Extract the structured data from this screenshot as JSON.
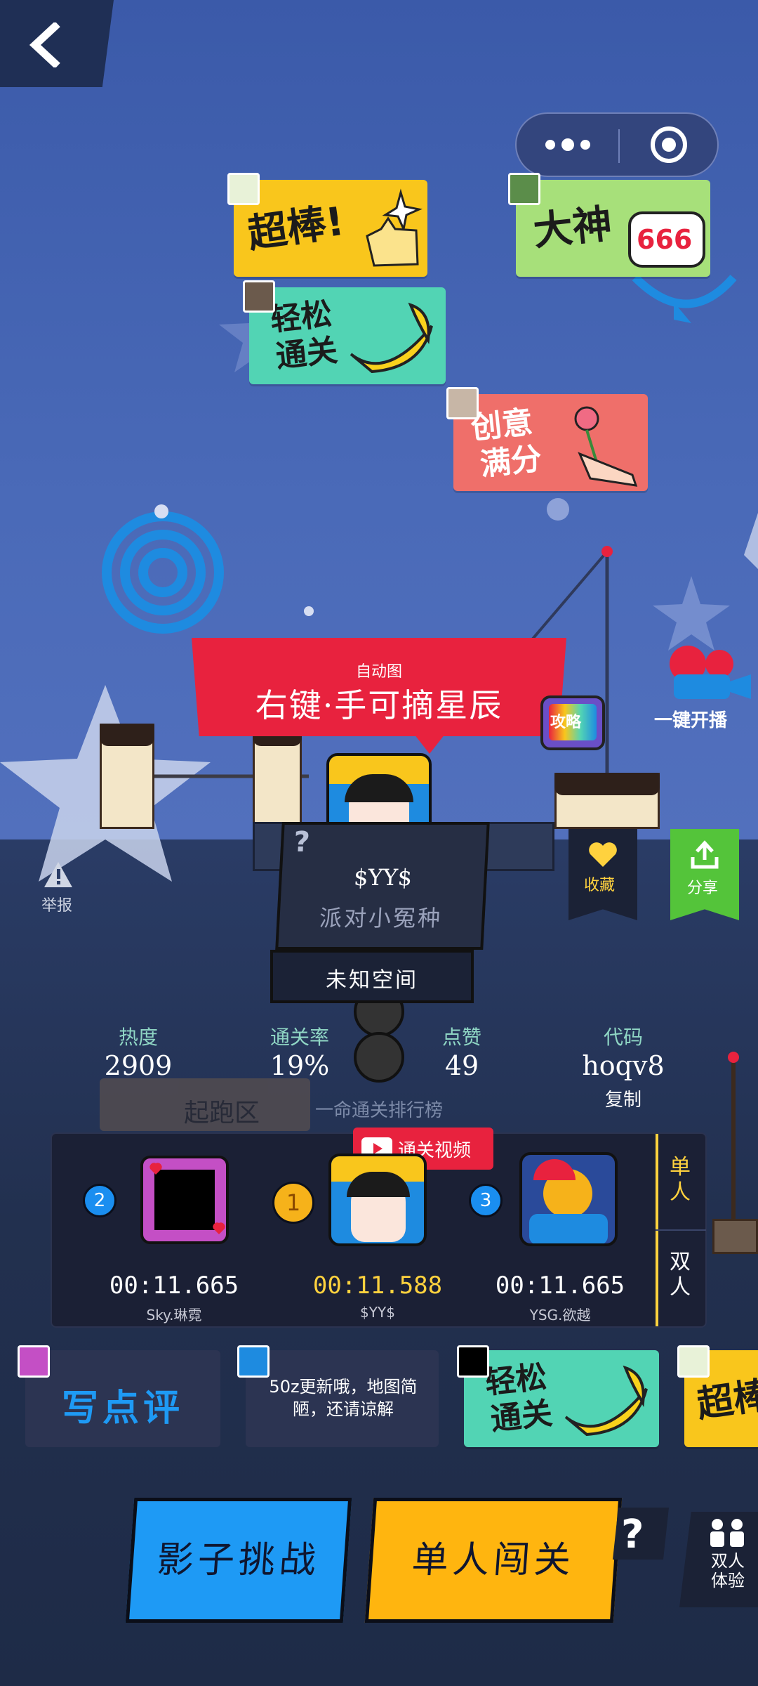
{
  "nav": {
    "back_icon": "chevron-left-icon"
  },
  "capsule": {
    "more_icon": "more-dots-icon",
    "target_icon": "target-icon"
  },
  "stickers": {
    "chaobang": "超棒!",
    "dashen": "大神",
    "dashen_badge": "666",
    "qingsong_line1": "轻松",
    "qingsong_line2": "通关",
    "chuangyi_line1": "创意",
    "chuangyi_line2": "满分"
  },
  "banner": {
    "subtitle": "自动图",
    "title": "右键·手可摘星辰"
  },
  "strategy_badge": "攻略",
  "live": {
    "label": "一键开播"
  },
  "report": {
    "label": "举报"
  },
  "favorite": {
    "label": "收藏"
  },
  "share": {
    "label": "分享"
  },
  "author": {
    "name": "$YY$",
    "title": "派对小冤种",
    "help": "?",
    "space": "未知空间"
  },
  "stats": {
    "heat_label": "热度",
    "heat_value": "2909",
    "pass_label": "通关率",
    "pass_value": "19%",
    "like_label": "点赞",
    "like_value": "49",
    "code_label": "代码",
    "code_value": "hoqv8",
    "copy_label": "复制"
  },
  "start_area": "起跑区",
  "leaderboard": {
    "title": "一命通关排行榜",
    "video_label": "通关视频",
    "tab_single": "单人",
    "tab_double": "双人",
    "entries": [
      {
        "rank": "2",
        "time": "00:11.665",
        "name": "Sky.琳霓"
      },
      {
        "rank": "1",
        "time": "00:11.588",
        "name": "$YY$"
      },
      {
        "rank": "3",
        "time": "00:11.665",
        "name": "YSG.欲越"
      }
    ],
    "colors": {
      "gold": "#ffd23e",
      "blue": "#1a8ef0"
    }
  },
  "comments": {
    "write_label": "写点评",
    "author_note": "50z更新哦，地图简陋，还请谅解",
    "tag_qingsong_1": "轻松",
    "tag_qingsong_2": "通关",
    "tag_chaobang": "超棒"
  },
  "buttons": {
    "shadow": "影子挑战",
    "single": "单人闯关",
    "help": "?",
    "duo": "双人体验"
  },
  "colors": {
    "banner_red": "#e8223e",
    "shadow_blue": "#1e9af5",
    "single_yellow": "#ffb50f",
    "share_green": "#54c43a"
  }
}
